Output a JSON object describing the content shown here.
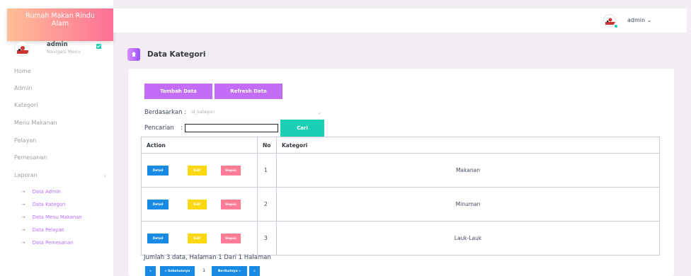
{
  "sidebar": {
    "brand_line1": "Rumah Makan Rindu",
    "brand_line2": "Alam",
    "profile": {
      "name": "admin",
      "subtitle": "Navigasi Menu"
    },
    "items": [
      {
        "label": "Home"
      },
      {
        "label": "Admin"
      },
      {
        "label": "Kategori"
      },
      {
        "label": "Menu Makanan"
      },
      {
        "label": "Pelayan"
      },
      {
        "label": "Pemesanan"
      },
      {
        "label": "Laporan"
      }
    ],
    "laporan_toggle": "‹",
    "sub_items": [
      {
        "label": "Data Admin"
      },
      {
        "label": "Data Kategori"
      },
      {
        "label": "Data Menu Makanan"
      },
      {
        "label": "Data Pelayan"
      },
      {
        "label": "Data Pemesanan"
      }
    ],
    "sub_arrow": "→"
  },
  "topbar": {
    "user": "admin ⌄"
  },
  "page": {
    "title": "Data Kategori"
  },
  "toolbar": {
    "add_label": "Tambah Data",
    "refresh_label": "Refresh Data"
  },
  "filter": {
    "by_label": "Berdasarkan :",
    "by_value": "id_kategori",
    "search_label": "Pencarian",
    "search_colon": ":",
    "search_value": "",
    "search_button": "Cari"
  },
  "table": {
    "headers": [
      "Action",
      "No",
      "Kategori"
    ],
    "action_labels": {
      "detail": "Detail",
      "edit": "Edit",
      "delete": "Hapus"
    },
    "rows": [
      {
        "no": "1",
        "kategori": "Makanan"
      },
      {
        "no": "2",
        "kategori": "Minuman"
      },
      {
        "no": "3",
        "kategori": "Lauk-Lauk"
      }
    ]
  },
  "summary": "Jumlah 3 data, Halaman 1 Dari 1 Halaman",
  "pagination": {
    "first": "«",
    "prev": "« Sebelumnya",
    "current": "1",
    "next": "Berikutnya »",
    "last": "»"
  },
  "colors": {
    "accent_purple": "#c36cf5",
    "teal": "#1bcfb4",
    "blue": "#198ae3",
    "yellow": "#fed713",
    "pink": "#fe7c96",
    "bg": "#f2edf3"
  }
}
